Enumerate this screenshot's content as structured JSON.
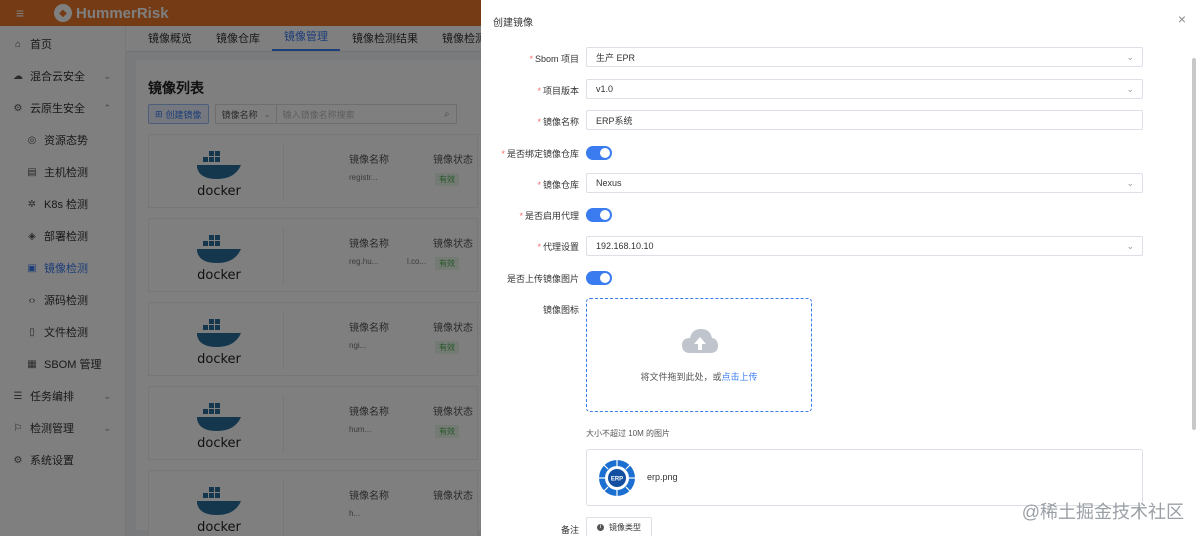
{
  "app": {
    "name": "HummerRisk"
  },
  "sidebar": {
    "items": [
      {
        "label": "首页",
        "icon": "home-icon"
      },
      {
        "label": "混合云安全",
        "icon": "cloud-icon"
      },
      {
        "label": "云原生安全",
        "icon": "cloud-native-icon"
      },
      {
        "label": "资源态势",
        "icon": "resource-icon"
      },
      {
        "label": "主机检测",
        "icon": "host-icon"
      },
      {
        "label": "K8s 检测",
        "icon": "k8s-icon"
      },
      {
        "label": "部署检测",
        "icon": "deploy-icon"
      },
      {
        "label": "镜像检测",
        "icon": "image-icon"
      },
      {
        "label": "源码检测",
        "icon": "code-icon"
      },
      {
        "label": "文件检测",
        "icon": "file-icon"
      },
      {
        "label": "SBOM 管理",
        "icon": "sbom-icon"
      },
      {
        "label": "任务编排",
        "icon": "task-icon"
      },
      {
        "label": "检测管理",
        "icon": "manage-icon"
      },
      {
        "label": "系统设置",
        "icon": "settings-icon"
      }
    ]
  },
  "tabs": [
    "镜像概览",
    "镜像仓库",
    "镜像管理",
    "镜像检测结果",
    "镜像检测历史记录"
  ],
  "panel": {
    "title": "镜像列表",
    "create_label": "创建镜像",
    "select_label": "镜像名称",
    "search_placeholder": "输入镜像名称搜索",
    "docker_word": "docker",
    "col_name": "镜像名称",
    "col_status": "镜像状态",
    "status_valid": "有效",
    "cards": [
      "registr...",
      "reg.hu...",
      "ngi...",
      "hum...",
      "h..."
    ],
    "card_extra": "l.co..."
  },
  "drawer": {
    "title": "创建镜像",
    "close": "×",
    "fields": {
      "sbom_label": "Sbom 项目",
      "sbom_value": "生产 EPR",
      "version_label": "项目版本",
      "version_value": "v1.0",
      "name_label": "镜像名称",
      "name_value": "ERP系统",
      "bind_repo_label": "是否绑定镜像仓库",
      "repo_label": "镜像仓库",
      "repo_value": "Nexus",
      "proxy_enable_label": "是否启用代理",
      "proxy_label": "代理设置",
      "proxy_value": "192.168.10.10",
      "upload_image_label": "是否上传镜像图片",
      "icon_label": "镜像图标",
      "upload_text": "将文件拖到此处，或",
      "upload_link": "点击上传",
      "upload_tip": "大小不超过 10M 的图片",
      "file_name": "erp.png",
      "file_icon_text": "ERP",
      "note_label": "备注",
      "note_chip": "镜像类型"
    }
  },
  "watermark": "@稀土掘金技术社区",
  "colors": {
    "brand": "#e8762b",
    "primary": "#3a7cf0",
    "required": "#f56c6c"
  }
}
